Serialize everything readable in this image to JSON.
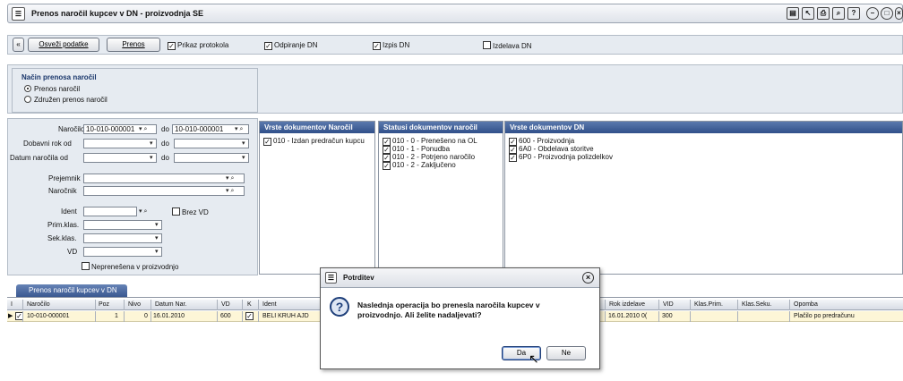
{
  "window": {
    "title": "Prenos naročil kupcev v DN - proizvodnja SE",
    "app_icon": "list-icon"
  },
  "toolbar": {
    "refresh": "Osveži podatke",
    "transfer": "Prenos",
    "show_protocol": "Prikaz protokola",
    "open_dn": "Odpiranje DN",
    "print_dn": "Izpis DN",
    "make_dn": "Izdelava DN"
  },
  "transfer_mode": {
    "heading": "Način prenosa naročil",
    "opt1": "Prenos naročil",
    "opt2": "Združen prenos naročil"
  },
  "filters": {
    "order_label": "Naročilo",
    "order_from": "10-010-000001",
    "order_to_label": "do",
    "order_to": "10-010-000001",
    "due_label": "Dobavni rok od",
    "due_to": "do",
    "date_label": "Datum naročila od",
    "date_to": "do",
    "recipient": "Prejemnik",
    "customer": "Naročnik",
    "ident": "Ident",
    "no_vd": "Brez VD",
    "prim": "Prim.klas.",
    "sek": "Sek.klas.",
    "vd": "VD",
    "untransferred": "Nepreneŝena v proizvodnjo"
  },
  "lists": {
    "doc_types_orders": {
      "heading": "Vrste dokumentov Naročil",
      "items": [
        "010 - Izdan predračun kupcu"
      ]
    },
    "order_statuses": {
      "heading": "Statusi dokumentov naročil",
      "items": [
        "010 - 0 - Preneŝeno na OL",
        "010 - 1 - Ponudba",
        "010 - 2 - Potrjeno naročilo",
        "010 - 2 - Zaključeno"
      ]
    },
    "doc_types_dn": {
      "heading": "Vrste dokumentov DN",
      "items": [
        "600 - Proizvodnja",
        "6A0 - Obdelava storitve",
        "6P0 - Proizvodnja polizdelkov"
      ]
    }
  },
  "grid": {
    "tab": "Prenos naročil kupcev v DN",
    "columns": [
      "I",
      "Naročilo",
      "Poz",
      "Nivo",
      "Datum Nar.",
      "VD",
      "K",
      "Ident",
      "Rok izdelave",
      "VID",
      "Klas.Prim.",
      "Klas.Seku.",
      "Opomba"
    ],
    "row": {
      "order": "10-010-000001",
      "pos": "1",
      "level": "0",
      "date": "16.01.2010",
      "vd": "600",
      "ident": "BELI KRUH AJD",
      "due": "16.01.2010 0(",
      "vid": "300",
      "note": "Plačilo po predračunu"
    }
  },
  "dialog": {
    "title": "Potrditev",
    "message_line1": "Naslednja operacija bo prenesla naročila kupcev v",
    "message_line2": "proizvodnjo. Ali želite nadaljevati?",
    "yes": "Da",
    "no": "Ne"
  }
}
